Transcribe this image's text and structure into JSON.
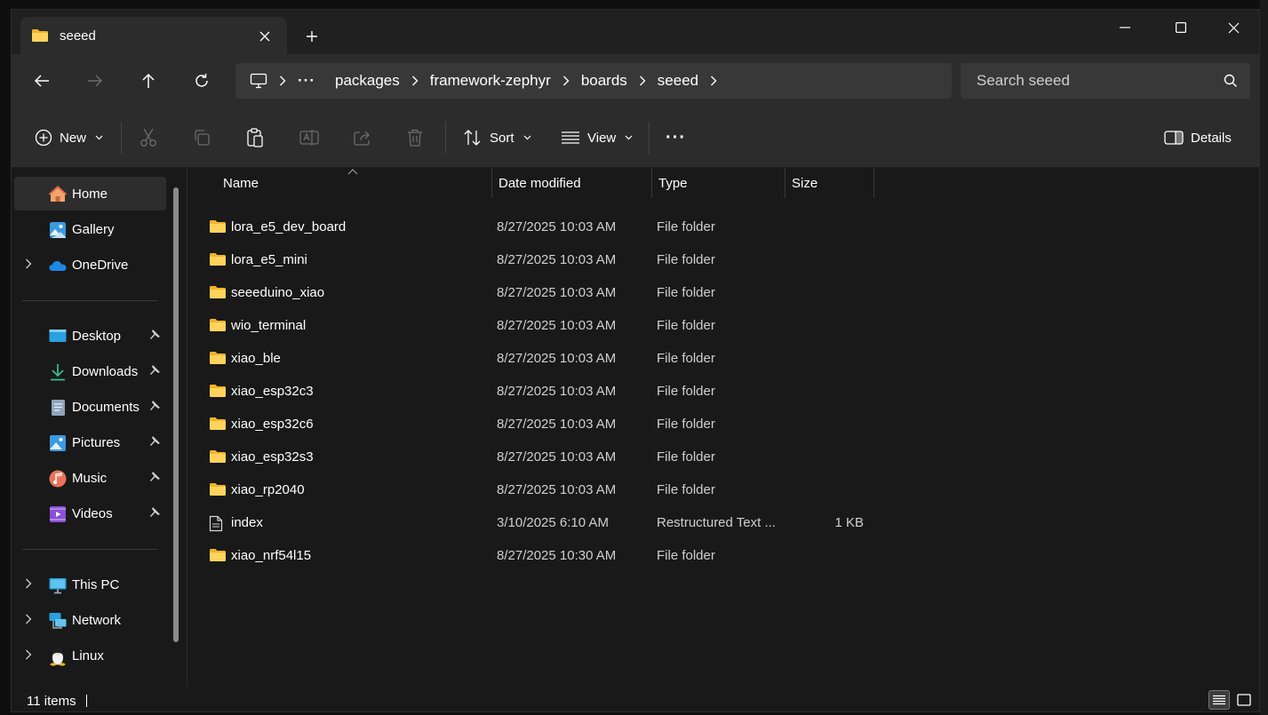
{
  "window": {
    "tab_title": "seeed",
    "colors": {
      "accent": "#ffc83d",
      "background": "#191919",
      "toolbar": "#2c2c2c"
    }
  },
  "breadcrumb": {
    "overflow": "···",
    "items": [
      "packages",
      "framework-zephyr",
      "boards",
      "seeed"
    ]
  },
  "search": {
    "placeholder": "Search seeed"
  },
  "command_bar": {
    "new_label": "New",
    "sort_label": "Sort",
    "view_label": "View",
    "more_label": "···",
    "details_label": "Details"
  },
  "sidebar": {
    "home": "Home",
    "gallery": "Gallery",
    "onedrive": "OneDrive",
    "quick_access": [
      {
        "label": "Desktop",
        "icon": "desktop-icon"
      },
      {
        "label": "Downloads",
        "icon": "downloads-icon"
      },
      {
        "label": "Documents",
        "icon": "documents-icon"
      },
      {
        "label": "Pictures",
        "icon": "pictures-icon"
      },
      {
        "label": "Music",
        "icon": "music-icon"
      },
      {
        "label": "Videos",
        "icon": "videos-icon"
      }
    ],
    "this_pc": "This PC",
    "network": "Network",
    "linux": "Linux"
  },
  "columns": {
    "name": "Name",
    "date": "Date modified",
    "type": "Type",
    "size": "Size"
  },
  "files": [
    {
      "name": "lora_e5_dev_board",
      "date": "8/27/2025 10:03 AM",
      "type": "File folder",
      "size": ""
    },
    {
      "name": "lora_e5_mini",
      "date": "8/27/2025 10:03 AM",
      "type": "File folder",
      "size": ""
    },
    {
      "name": "seeeduino_xiao",
      "date": "8/27/2025 10:03 AM",
      "type": "File folder",
      "size": ""
    },
    {
      "name": "wio_terminal",
      "date": "8/27/2025 10:03 AM",
      "type": "File folder",
      "size": ""
    },
    {
      "name": "xiao_ble",
      "date": "8/27/2025 10:03 AM",
      "type": "File folder",
      "size": ""
    },
    {
      "name": "xiao_esp32c3",
      "date": "8/27/2025 10:03 AM",
      "type": "File folder",
      "size": ""
    },
    {
      "name": "xiao_esp32c6",
      "date": "8/27/2025 10:03 AM",
      "type": "File folder",
      "size": ""
    },
    {
      "name": "xiao_esp32s3",
      "date": "8/27/2025 10:03 AM",
      "type": "File folder",
      "size": ""
    },
    {
      "name": "xiao_rp2040",
      "date": "8/27/2025 10:03 AM",
      "type": "File folder",
      "size": ""
    },
    {
      "name": "index",
      "date": "3/10/2025 6:10 AM",
      "type": "Restructured Text ...",
      "size": "1 KB"
    },
    {
      "name": "xiao_nrf54l15",
      "date": "8/27/2025 10:30 AM",
      "type": "File folder",
      "size": ""
    }
  ],
  "status": {
    "item_count": "11 items"
  }
}
